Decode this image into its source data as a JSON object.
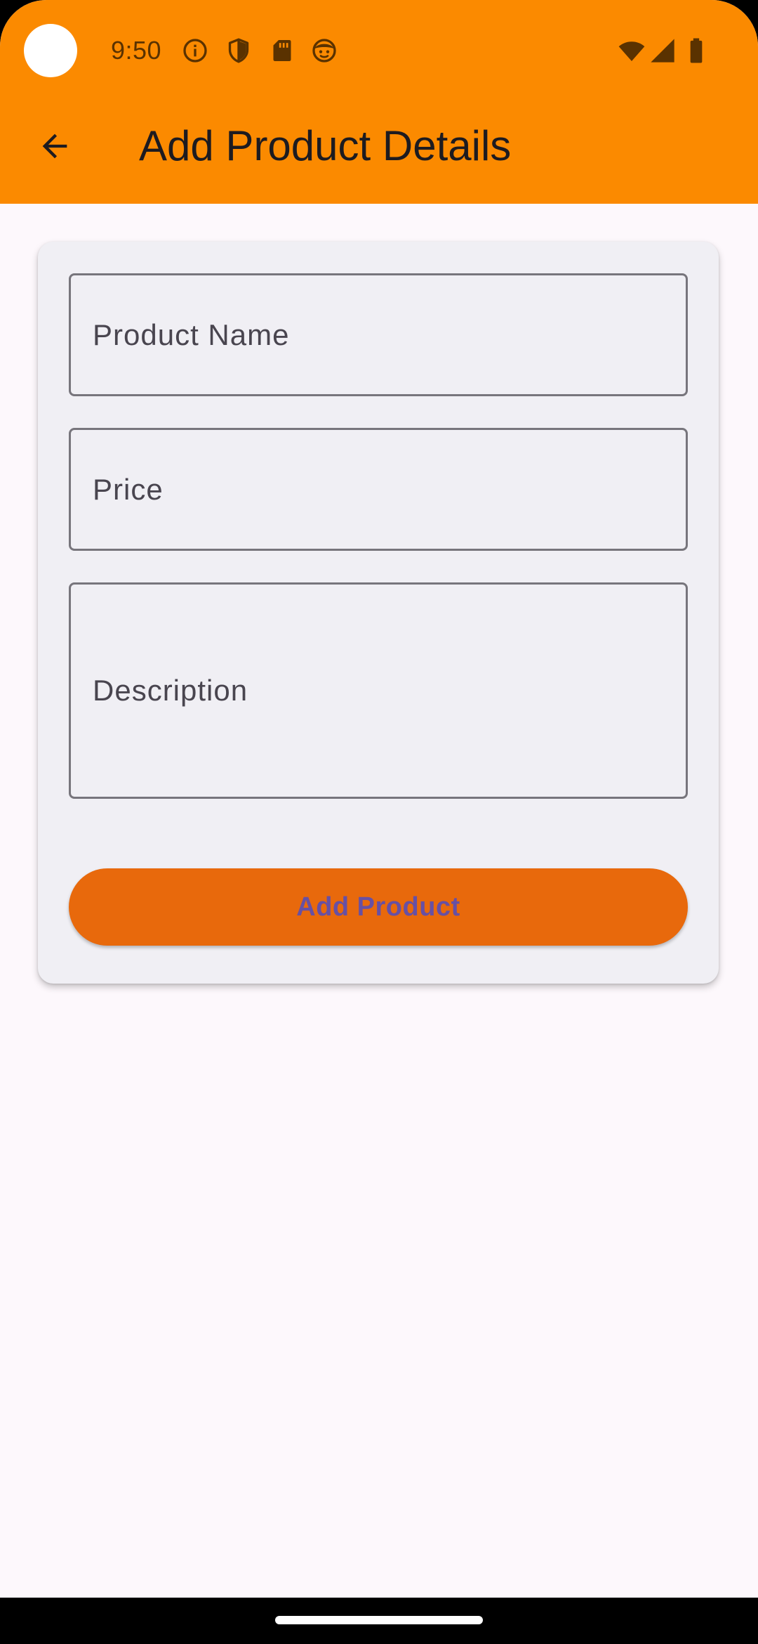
{
  "status_bar": {
    "time": "9:50",
    "left_icons": [
      "info-icon",
      "shield-icon",
      "sd-card-icon",
      "face-icon"
    ],
    "right_icons": [
      "wifi-icon",
      "signal-icon",
      "battery-icon"
    ]
  },
  "app_bar": {
    "back_icon": "arrow-back-icon",
    "title": "Add Product Details"
  },
  "form": {
    "product_name_label": "Product Name",
    "price_label": "Price",
    "description_label": "Description",
    "submit_label": "Add Product"
  },
  "colors": {
    "app_bar": "#FB8A00",
    "button": "#E8690C",
    "button_text": "#6750A4",
    "card": "#F0EFF4",
    "background": "#FDF8FC"
  }
}
